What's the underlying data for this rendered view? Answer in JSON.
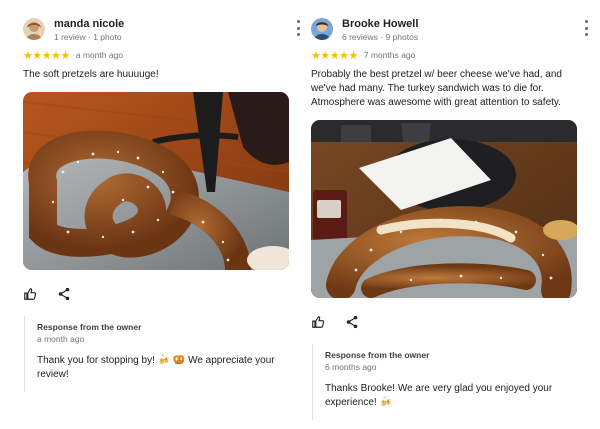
{
  "reviews": [
    {
      "author": "manda nicole",
      "meta": "1 review · 1 photo",
      "stars": "★★★★★",
      "when": "a month ago",
      "text": "The soft pretzels are huuuuge!",
      "photo_icon": "pretzel-photo",
      "response": {
        "title": "Response from the owner",
        "when": "a month ago",
        "text": "Thank you for stopping by! 🍻 🥨 We appreciate your review!"
      }
    },
    {
      "author": "Brooke Howell",
      "meta": "6 reviews · 9 photos",
      "stars": "★★★★★",
      "when": "7 months ago",
      "text": "Probably the best pretzel w/ beer cheese we've had, and we've had many. The turkey sandwich was to die for. Atmosphere was awesome with great attention to safety.",
      "photo_icon": "pretzel-photo",
      "response": {
        "title": "Response from the owner",
        "when": "6 months ago",
        "text": "Thanks Brooke! We are very glad you enjoyed your experience! 🍻"
      }
    }
  ],
  "colors": {
    "star": "#fbbc04",
    "text": "#202124",
    "muted": "#70757a",
    "pretzel": "#8a4a1c"
  },
  "icons": {
    "like": "thumbs-up-icon",
    "share": "share-icon",
    "more": "more-vert-icon"
  }
}
